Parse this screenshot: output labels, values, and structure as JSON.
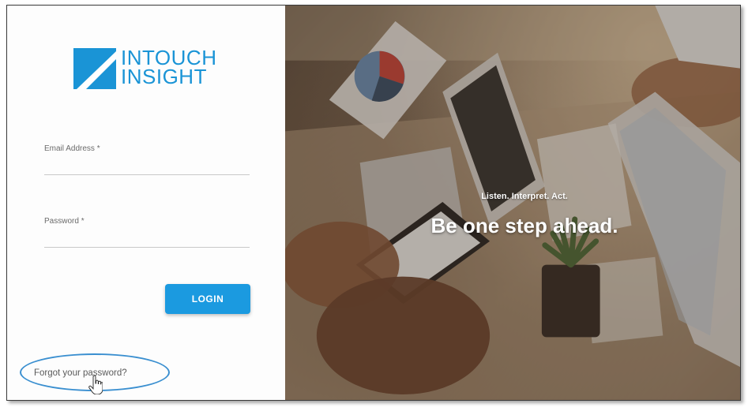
{
  "brand": {
    "line1": "INTOUCH",
    "line2": "INSIGHT",
    "color": "#1a94d6"
  },
  "login_form": {
    "email": {
      "label": "Email Address",
      "required_mark": "*",
      "value": ""
    },
    "password": {
      "label": "Password",
      "required_mark": "*",
      "value": ""
    },
    "login_label": "LOGIN",
    "forgot_label": "Forgot your password?"
  },
  "hero": {
    "tagline": "Listen. Interpret. Act.",
    "headline": "Be one step ahead."
  },
  "colors": {
    "accent": "#1b9ae0",
    "highlight_ring": "#3a8fd0"
  },
  "icons": {
    "logo": "intouch-insight-logo-mark",
    "cursor": "hand-pointer-icon"
  }
}
